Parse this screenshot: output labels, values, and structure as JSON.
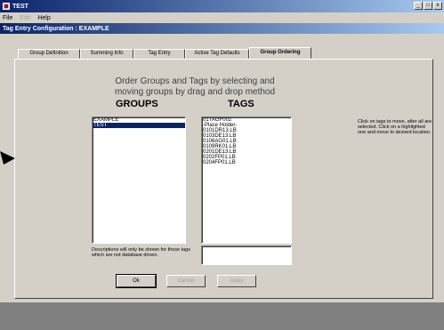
{
  "window": {
    "title": "TEST",
    "controls": [
      "_",
      "□",
      "x"
    ]
  },
  "menu": {
    "items": [
      {
        "label": "File",
        "enabled": true
      },
      {
        "label": "Edit",
        "enabled": false
      },
      {
        "label": "Help",
        "enabled": true
      }
    ]
  },
  "subwindow": {
    "title": "Tag Entry Configuration : EXAMPLE"
  },
  "tabs": [
    {
      "label": "Group Definition",
      "active": false
    },
    {
      "label": "Summing Info",
      "active": false
    },
    {
      "label": "Tag Entry",
      "active": false
    },
    {
      "label": "Active Tag Defaults",
      "active": false
    },
    {
      "label": "Group Ordering",
      "active": true
    }
  ],
  "panel": {
    "instruction_line1": "Order Groups and Tags by selecting and",
    "instruction_line2": "moving groups by drag and drop method",
    "groups_header": "GROUPS",
    "tags_header": "TAGS",
    "groups": [
      {
        "label": "EXAMPLE",
        "selected": false
      },
      {
        "label": "TEST",
        "selected": true
      }
    ],
    "tags": [
      "01TAGF002",
      "-Place Holder-",
      "0101DR13.LB",
      "0103DE13.LB",
      "0106AG01.LB",
      "0109RK01.LB",
      "0201DE13.LB",
      "0202FP01.LB",
      "0204FP01.LB"
    ],
    "hint": "Click on tags to move, after all are selected. Click on a highlighted one and move to desired location.",
    "note": "Descriptions will only be shown for those tags which are not database driven.",
    "description_value": ""
  },
  "buttons": {
    "ok": "Ok",
    "cancel": "Cancel",
    "apply": "Apply"
  },
  "colors": {
    "titlebar": "#0a246a",
    "selection": "#0a246a",
    "face": "#d4d0c8"
  }
}
